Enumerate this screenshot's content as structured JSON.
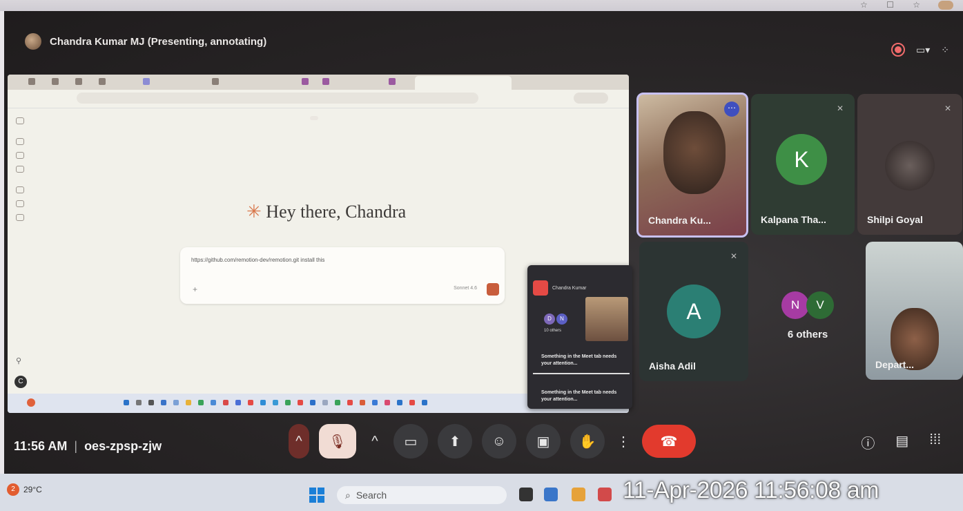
{
  "meet": {
    "presenter_label": "Chandra Kumar MJ (Presenting, annotating)",
    "meeting_time": "11:56 AM",
    "meeting_code": "oes-zpsp-zjw"
  },
  "shared_screen": {
    "greeting": "Hey there, Chandra",
    "greeting_icon": "asterisk-icon",
    "prompt_text": "https://github.com/remotion-dev/remotion.git install this",
    "model_label": "Sonnet 4.6",
    "rail_letter": "C"
  },
  "popup": {
    "presenter_short": "Chandra Kumar",
    "avatar_d": "D",
    "avatar_n": "N",
    "others": "10 others",
    "message_1": "Something in the Meet tab needs your attention...",
    "message_2": "Something in the Meet tab needs your attention..."
  },
  "participants": [
    {
      "name": "Chandra Ku...",
      "initial": ""
    },
    {
      "name": "Kalpana Tha...",
      "initial": "K"
    },
    {
      "name": "Shilpi Goyal",
      "initial": ""
    },
    {
      "name": "Aisha Adil",
      "initial": "A"
    },
    {
      "name": "6 others",
      "initial": "N",
      "initial2": "V"
    },
    {
      "name": "Depart...",
      "initial": ""
    }
  ],
  "taskbar": {
    "temperature": "29°C",
    "weather_badge": "2",
    "search_placeholder": "Search",
    "timestamp_overlay": "11-Apr-2026 11:56:08 am"
  },
  "colors": {
    "end_call": "#e23a2d",
    "mic_muted_bg": "#f1dcd4",
    "kalpana_avatar": "#3e8f46",
    "aisha_avatar": "#2b7f74",
    "n_avatar": "#a63ba3",
    "v_avatar": "#2e6b35",
    "active_speaker_border": "#c8c1f2"
  }
}
